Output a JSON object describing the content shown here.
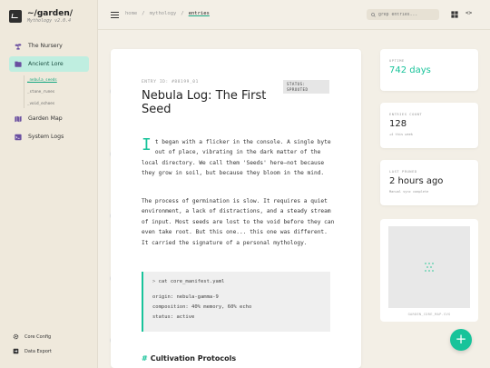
{
  "app": {
    "title": "~/garden/",
    "subtitle": "Mythology v2.0.4"
  },
  "sidebar": {
    "items": [
      {
        "label": "The Nursery",
        "icon": "sprout-icon"
      },
      {
        "label": "Ancient Lore",
        "icon": "folder-icon",
        "active": true
      },
      {
        "label": "Garden Map",
        "icon": "map-icon"
      },
      {
        "label": "System Logs",
        "icon": "terminal-icon"
      }
    ],
    "subitems": [
      {
        "label": "_nebula_seeds",
        "active": true
      },
      {
        "label": "_stone_runes"
      },
      {
        "label": "_void_echoes"
      }
    ],
    "footer": [
      {
        "label": "Core Config",
        "icon": "gear-icon"
      },
      {
        "label": "Data Export",
        "icon": "export-icon"
      }
    ]
  },
  "topbar": {
    "crumbs": [
      "home",
      "/",
      "mythology",
      "/",
      "entries"
    ],
    "search_placeholder": "grep entries..."
  },
  "entry": {
    "id": "ENTRY ID: #88199_01",
    "status": "STATUS: SPROUTED",
    "title": "Nebula Log: The First Seed",
    "dropcap": "I",
    "para1": "t began with a flicker in the console. A single byte out of place, vibrating in the dark matter of the local directory. We call them 'Seeds' here—not because they grow in soil, but because they bloom in the mind.",
    "para2": "The process of germination is slow. It requires a quiet environment, a lack of distractions, and a steady stream of input. Most seeds are lost to the void before they can even take root. But this one... this one was different. It carried the signature of a personal mythology.",
    "code": {
      "command": "cat core_manifest.yaml",
      "lines": [
        "origin: nebula-gamma-9",
        "composition: 40% memory, 60% echo",
        "status: active"
      ]
    },
    "section_heading": "Cultivation Protocols"
  },
  "widgets": {
    "uptime": {
      "label": "UPTIME",
      "value": "742 days"
    },
    "entries": {
      "label": "ENTRIES COUNT",
      "value": "128",
      "sub": "+4 this week"
    },
    "pruned": {
      "label": "LAST PRUNED",
      "value": "2 hours ago",
      "sub": "Manual sync complete"
    },
    "thumb_caption": "GARDEN_CORE_MAP.SVG"
  },
  "colors": {
    "accent": "#18c39a",
    "active_nav_bg": "#bfeee0",
    "background": "#f3efe6"
  }
}
